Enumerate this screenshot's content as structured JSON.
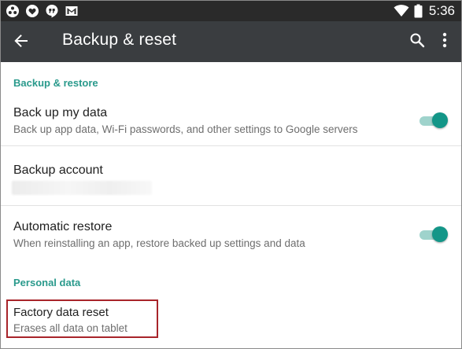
{
  "status_bar": {
    "time": "5:36",
    "left_icons": [
      "settings-dots-icon",
      "heart-shield-icon",
      "hangouts-icon",
      "gmail-icon"
    ],
    "right_icons": [
      "wifi-icon",
      "battery-icon"
    ]
  },
  "app_bar": {
    "title": "Backup & reset",
    "back_icon": "arrow-back-icon",
    "search_icon": "search-icon",
    "overflow_icon": "overflow-menu-icon"
  },
  "sections": {
    "backup_restore": {
      "header": "Backup & restore",
      "items": {
        "backup_data": {
          "title": "Back up my data",
          "summary": "Back up app data, Wi-Fi passwords, and other settings to Google servers",
          "enabled": true
        },
        "backup_account": {
          "title": "Backup account",
          "summary": ""
        },
        "auto_restore": {
          "title": "Automatic restore",
          "summary": "When reinstalling an app, restore backed up settings and data",
          "enabled": true
        }
      }
    },
    "personal_data": {
      "header": "Personal data",
      "items": {
        "factory_reset": {
          "title": "Factory data reset",
          "summary": "Erases all data on tablet"
        }
      }
    }
  },
  "colors": {
    "status_bar": "#2a2a2a",
    "app_bar": "#3a3d40",
    "accent": "#139688",
    "section_header": "#2a9a8c",
    "highlight": "#a8242a"
  }
}
